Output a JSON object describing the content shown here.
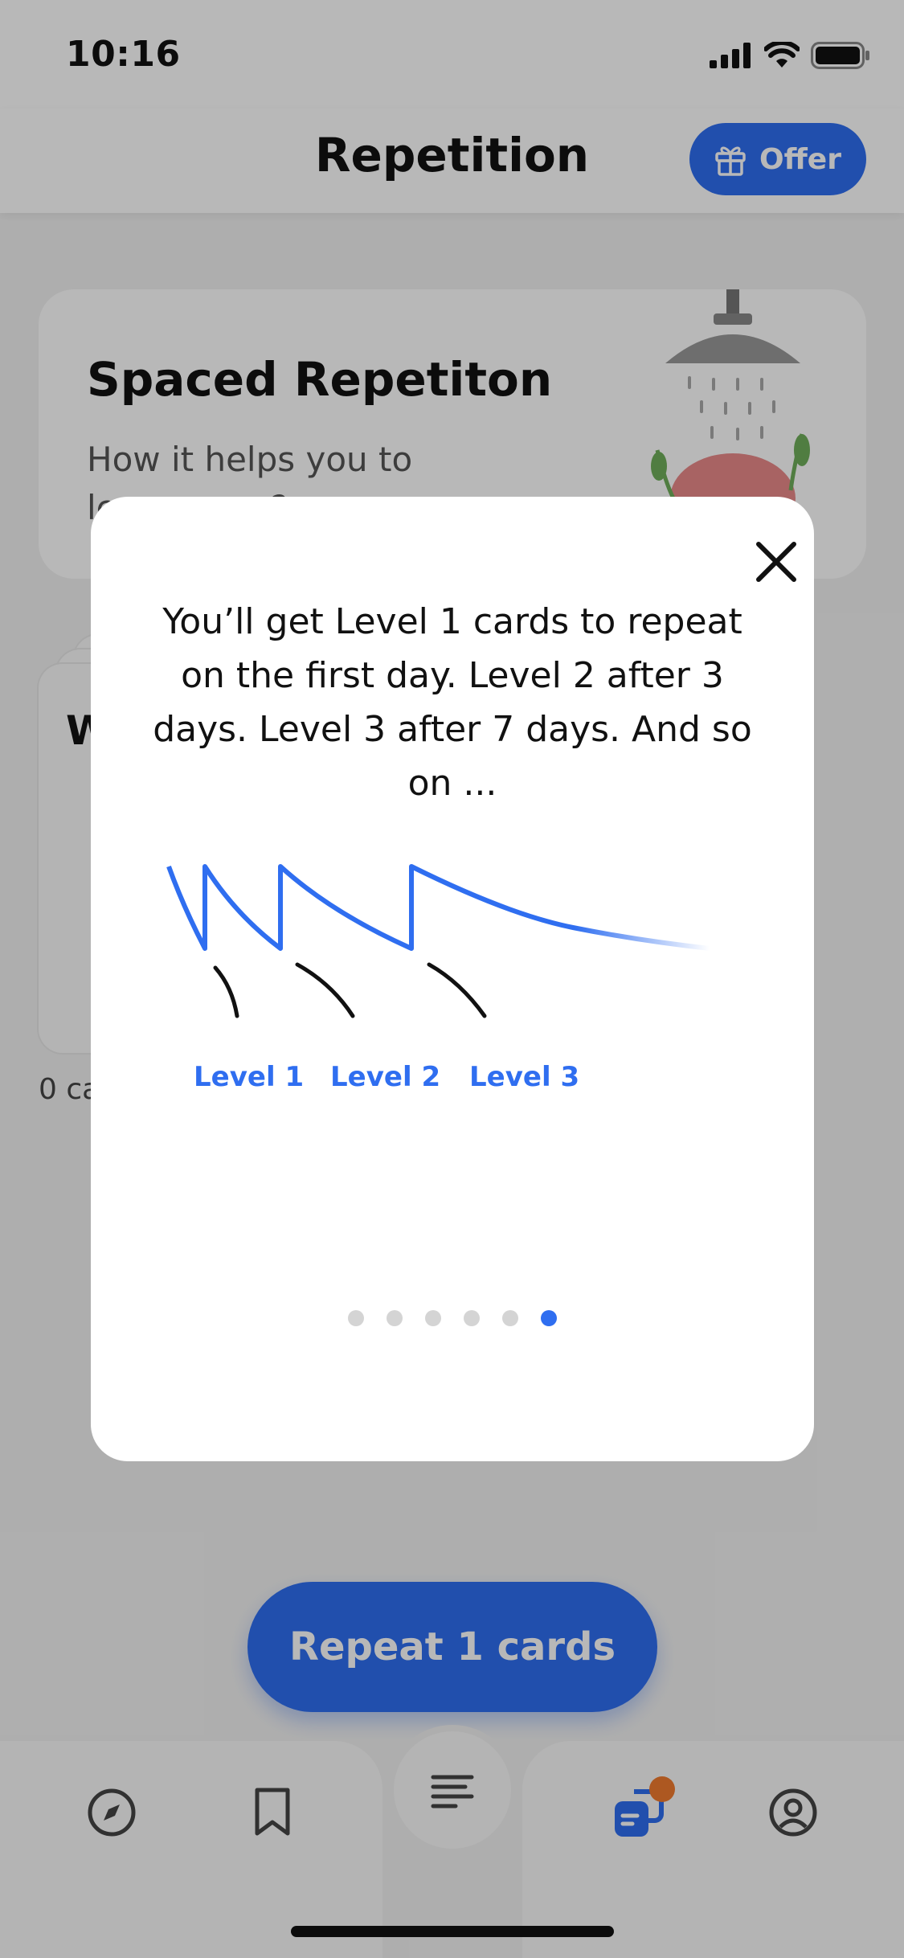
{
  "status_bar": {
    "time": "10:16"
  },
  "header": {
    "title": "Repetition",
    "offer_label": "Offer"
  },
  "info_card": {
    "title": "Spaced Repetiton",
    "subtitle": "How it helps you to learn more?"
  },
  "deck": {
    "letter": "W",
    "count_text": "0 cards"
  },
  "repeat_button": {
    "label": "Repeat 1 cards"
  },
  "modal": {
    "text": "You’ll get Level 1 cards to repeat on the first day. Level 2 after 3 days. Level 3 after 7 days. And so on ...",
    "levels": [
      "Level 1",
      "Level 2",
      "Level 3"
    ],
    "pagination": {
      "total": 6,
      "active_index": 5
    }
  },
  "tab_bar": {
    "items": [
      {
        "icon": "compass-icon"
      },
      {
        "icon": "bookmark-icon"
      },
      {
        "icon": "list-icon"
      },
      {
        "icon": "repetition-icon",
        "badge": true
      },
      {
        "icon": "profile-icon"
      }
    ]
  },
  "colors": {
    "accent": "#2f6ef0",
    "badge": "#f07b2e",
    "overlay": "rgba(0,0,0,0.28)"
  }
}
